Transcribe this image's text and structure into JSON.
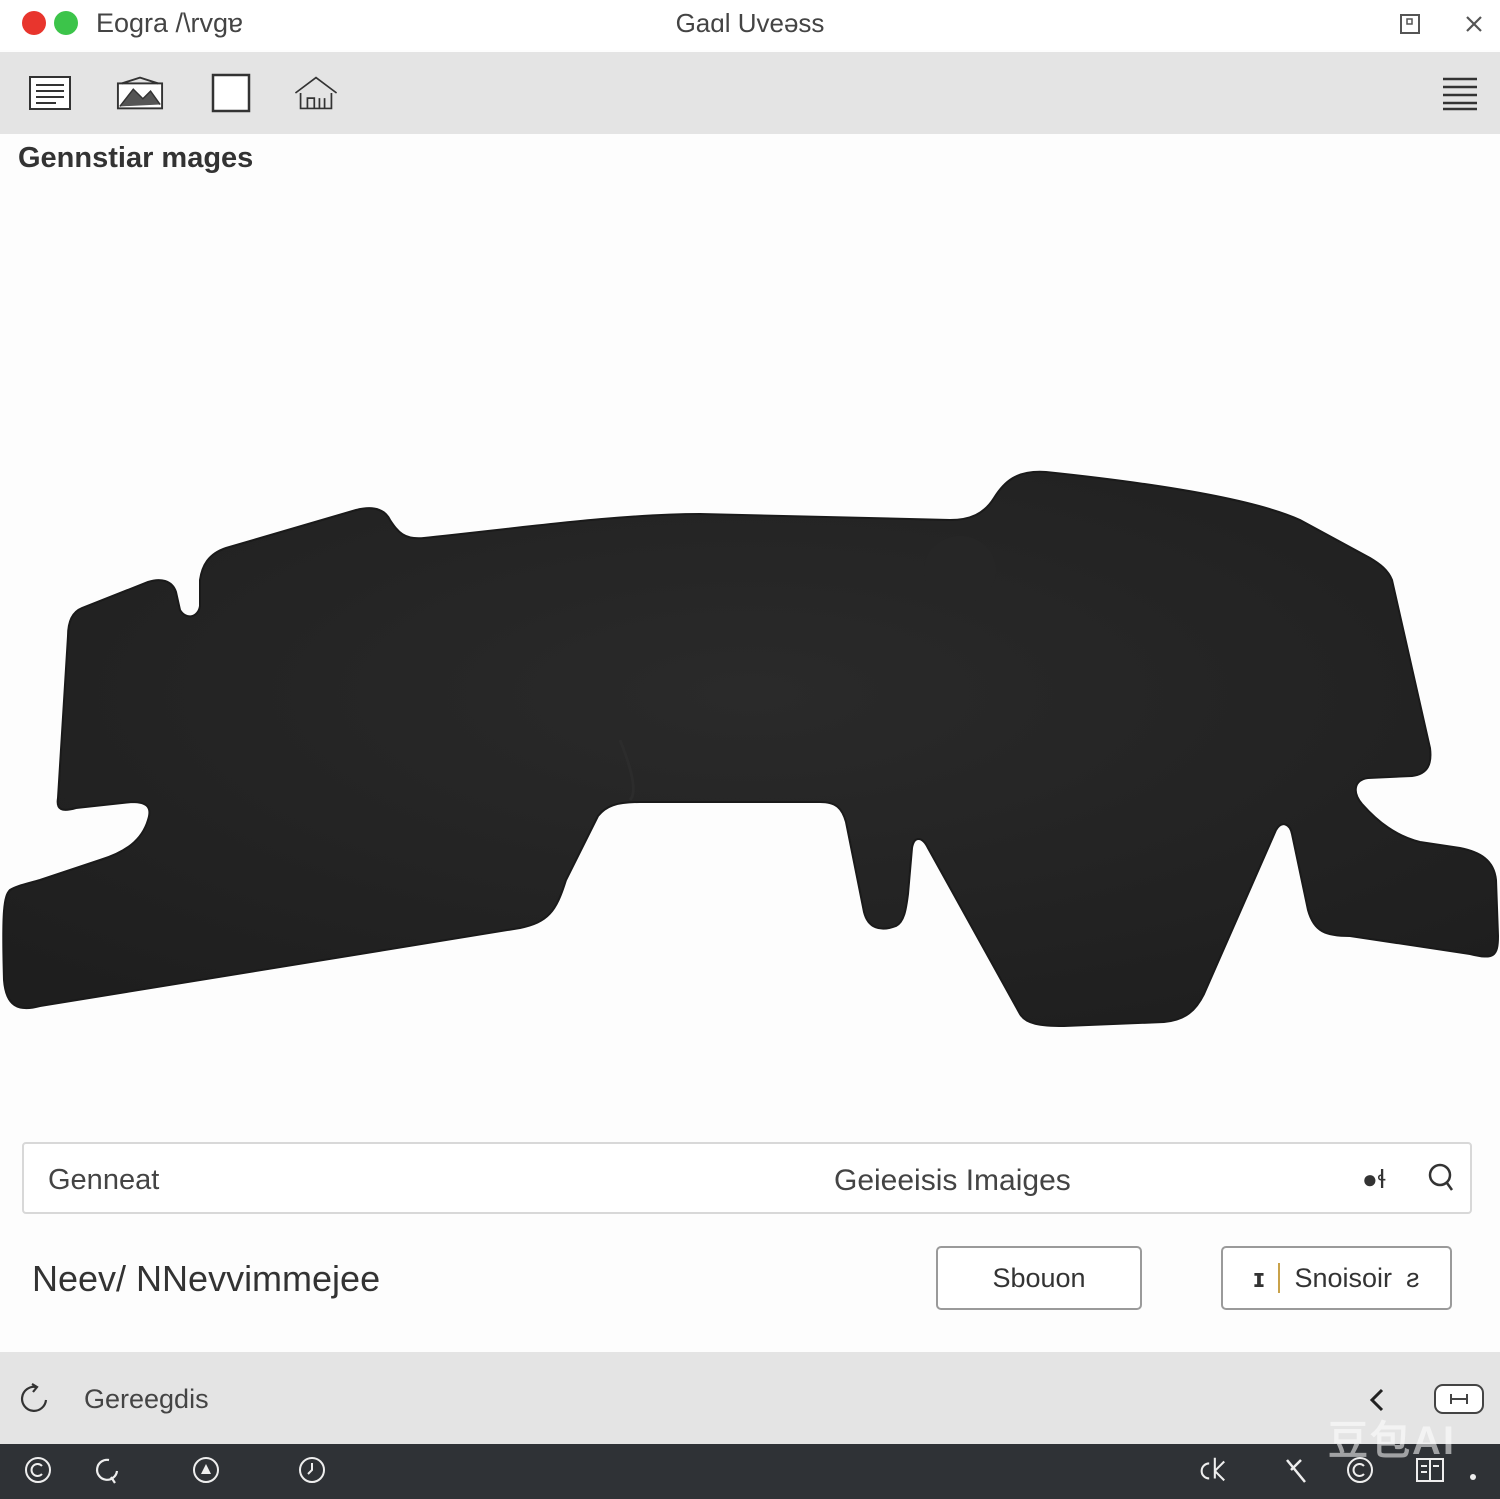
{
  "window": {
    "app_name": "Eogra /\\rvgɐ",
    "title": "Gaɑl Uveəss",
    "controls": {
      "restore_icon": "window-restore-icon",
      "close_icon": "close-icon"
    },
    "traffic_lights": [
      "#e8352d",
      "#3cc44a"
    ]
  },
  "toolbar": {
    "tools": [
      {
        "name": "document-icon"
      },
      {
        "name": "image-gallery-icon"
      },
      {
        "name": "frame-icon"
      },
      {
        "name": "house-icon"
      }
    ],
    "menu_icon": "hamburger-menu-icon"
  },
  "page": {
    "heading": "Gennstiar mages"
  },
  "search": {
    "value": "Genneat",
    "center_text": "Geieeisis Imaiges",
    "extra_text": "●ɬ",
    "icon": "search-icon"
  },
  "actions": {
    "caption": "Neev/ NNevvimmejee",
    "button_one": "Sbouon",
    "button_two_prefix": "ɪ",
    "button_two": "Snoisoir",
    "button_two_suffix": "ƨ"
  },
  "status": {
    "text": "Gereegdis",
    "left_icon": "refresh-icon",
    "back_icon": "chevron-left-icon",
    "panel_icon": "panel-toggle-icon"
  },
  "taskbar": {
    "left_icons": [
      "copyright-icon",
      "chat-icon",
      "nav-icon",
      "clock-icon"
    ],
    "right_icons": [
      "chart-icon",
      "x-icon",
      "copyright-icon",
      "grid-icon"
    ]
  },
  "watermark": "豆包AI",
  "colors": {
    "chrome": "#e4e4e4",
    "taskbar": "#2f3236",
    "object": "#232323"
  }
}
